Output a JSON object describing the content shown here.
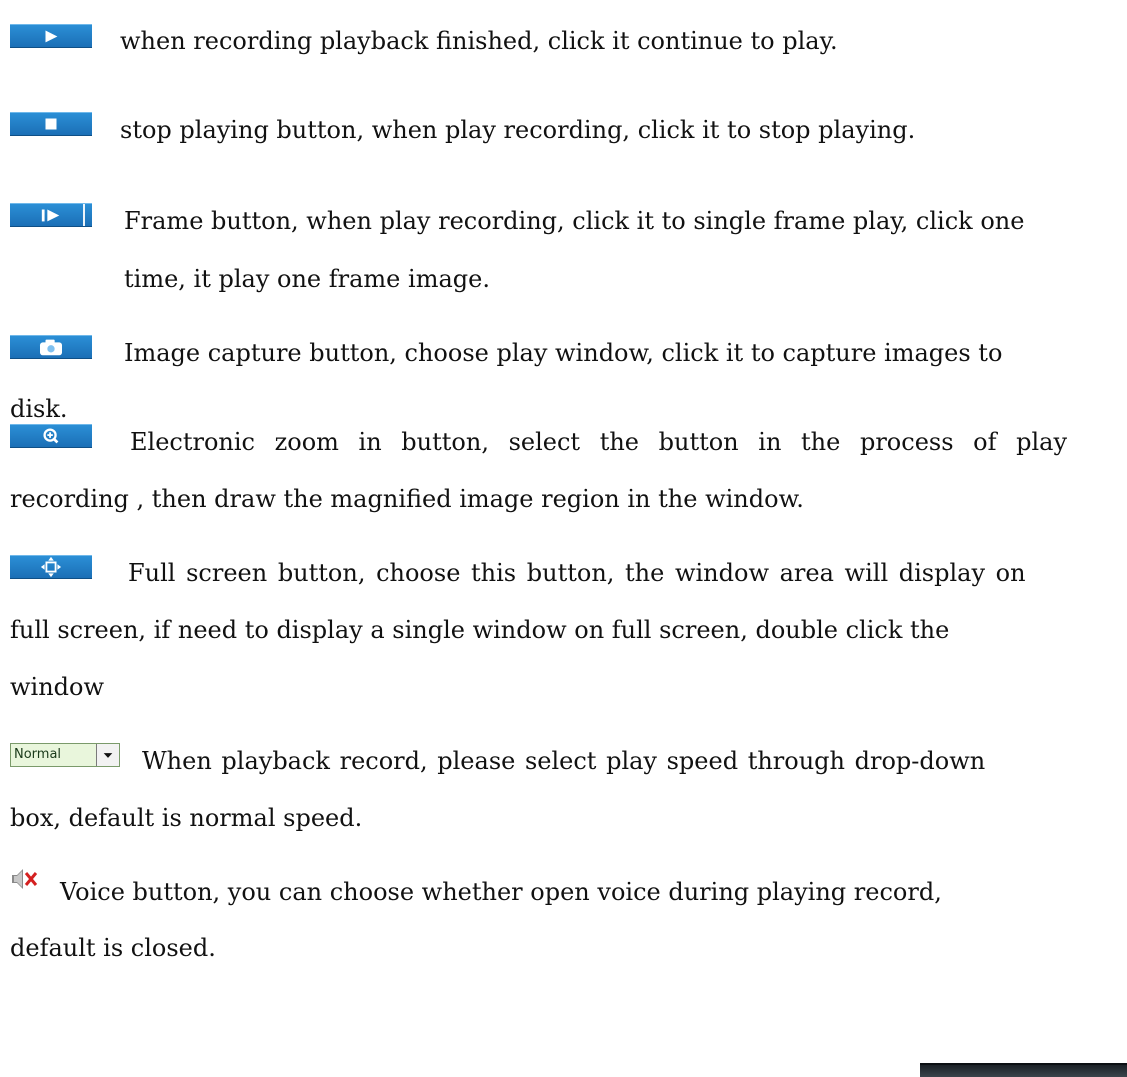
{
  "items": {
    "play": {
      "icon": "play-icon",
      "lines": [
        "when recording playback finished, click it continue to play."
      ]
    },
    "stop": {
      "icon": "stop-icon",
      "lines": [
        "stop playing button, when play recording, click it to stop playing."
      ]
    },
    "frame": {
      "icon": "frame-step-icon",
      "lines": [
        "Frame button, when play recording, click it to single frame play, click one",
        "time, it play one frame image."
      ]
    },
    "capture": {
      "icon": "camera-icon",
      "lines": [
        "Image capture button, choose play window, click it to capture images to",
        "disk."
      ]
    },
    "zoom": {
      "icon": "zoom-in-icon",
      "lines": [
        "Electronic zoom in button, select the button in the process of play",
        "recording , then draw the magnified image region in the window."
      ]
    },
    "full": {
      "icon": "fullscreen-icon",
      "lines": [
        "Full screen button, choose this button, the window area will display on",
        "full screen, if need to display a single window on full screen, double click the",
        "window"
      ]
    },
    "speed": {
      "icon": "dropdown-arrow-icon",
      "select_value": "Normal",
      "lines": [
        "When playback record, please select play speed through drop-down",
        "box, default is normal speed."
      ]
    },
    "voice": {
      "icon": "speaker-muted-icon",
      "lines": [
        "Voice button, you can choose whether open voice during playing record,",
        "default is closed."
      ]
    }
  },
  "colors": {
    "button_blue": "#1f7fc8",
    "select_bg": "#e9f6dc",
    "mute_red": "#d42020"
  }
}
